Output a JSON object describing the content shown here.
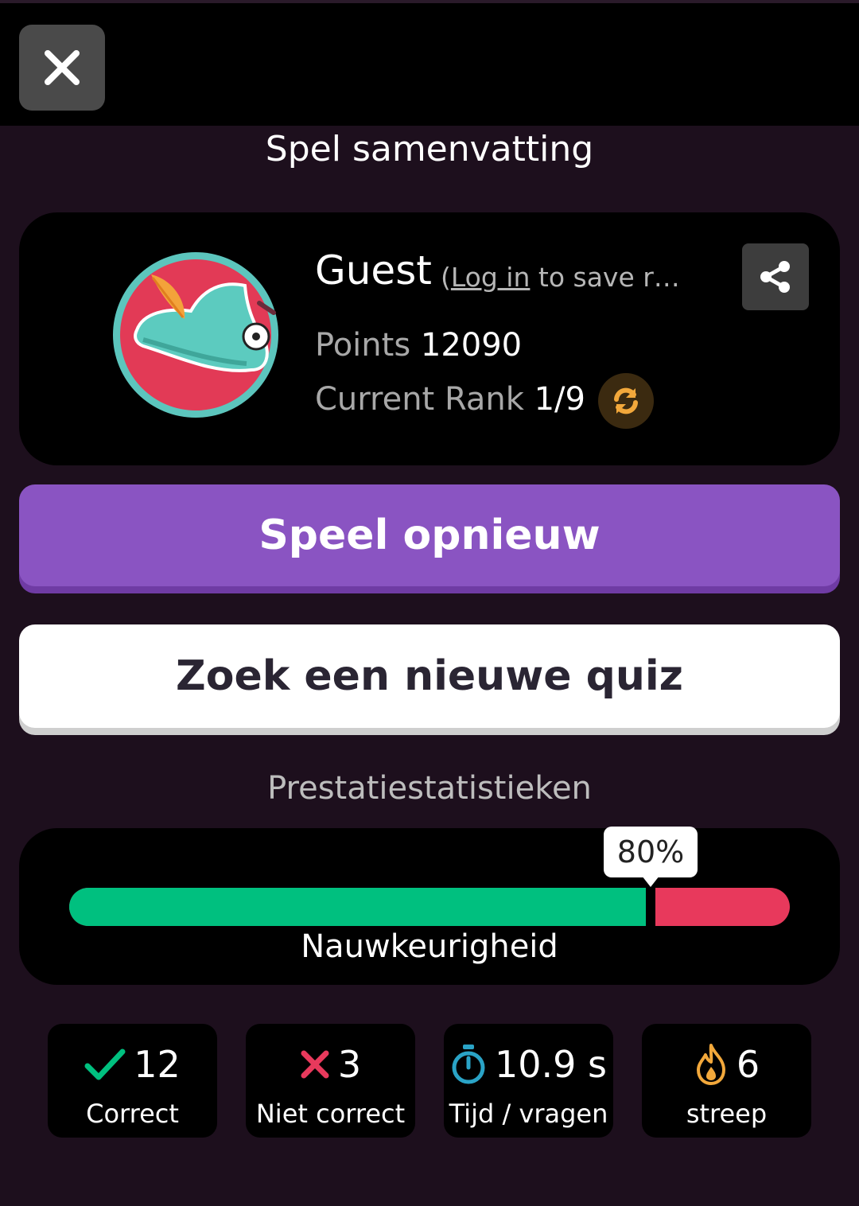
{
  "header": {
    "close_icon": "close-icon"
  },
  "page_title": "Spel samenvatting",
  "profile": {
    "username": "Guest",
    "login_link": "Log in",
    "login_open": "(",
    "login_rest": " to save r…",
    "points_label": "Points",
    "points_value": "12090",
    "rank_label": "Current Rank",
    "rank_value": "1/9",
    "avatar_icon": "robin-hood-hat-icon"
  },
  "actions": {
    "play_again": "Speel opnieuw",
    "find_quiz": "Zoek een nieuwe quiz"
  },
  "stats": {
    "heading": "Prestatiestatistieken",
    "accuracy_label": "Nauwkeurigheid",
    "accuracy_percent_text": "80%",
    "accuracy_fraction": 0.8,
    "colors": {
      "correct": "#00c07f",
      "incorrect": "#e8395c",
      "accent": "#8a54c2",
      "streak": "#f2a83b",
      "time": "#2aa3c6"
    },
    "boxes": [
      {
        "icon": "check-icon",
        "value": "12",
        "label": "Correct"
      },
      {
        "icon": "cross-icon",
        "value": "3",
        "label": "Niet correct"
      },
      {
        "icon": "stopwatch-icon",
        "value": "10.9 s",
        "label": "Tijd / vragen"
      },
      {
        "icon": "flame-icon",
        "value": "6",
        "label": "streep"
      }
    ]
  }
}
